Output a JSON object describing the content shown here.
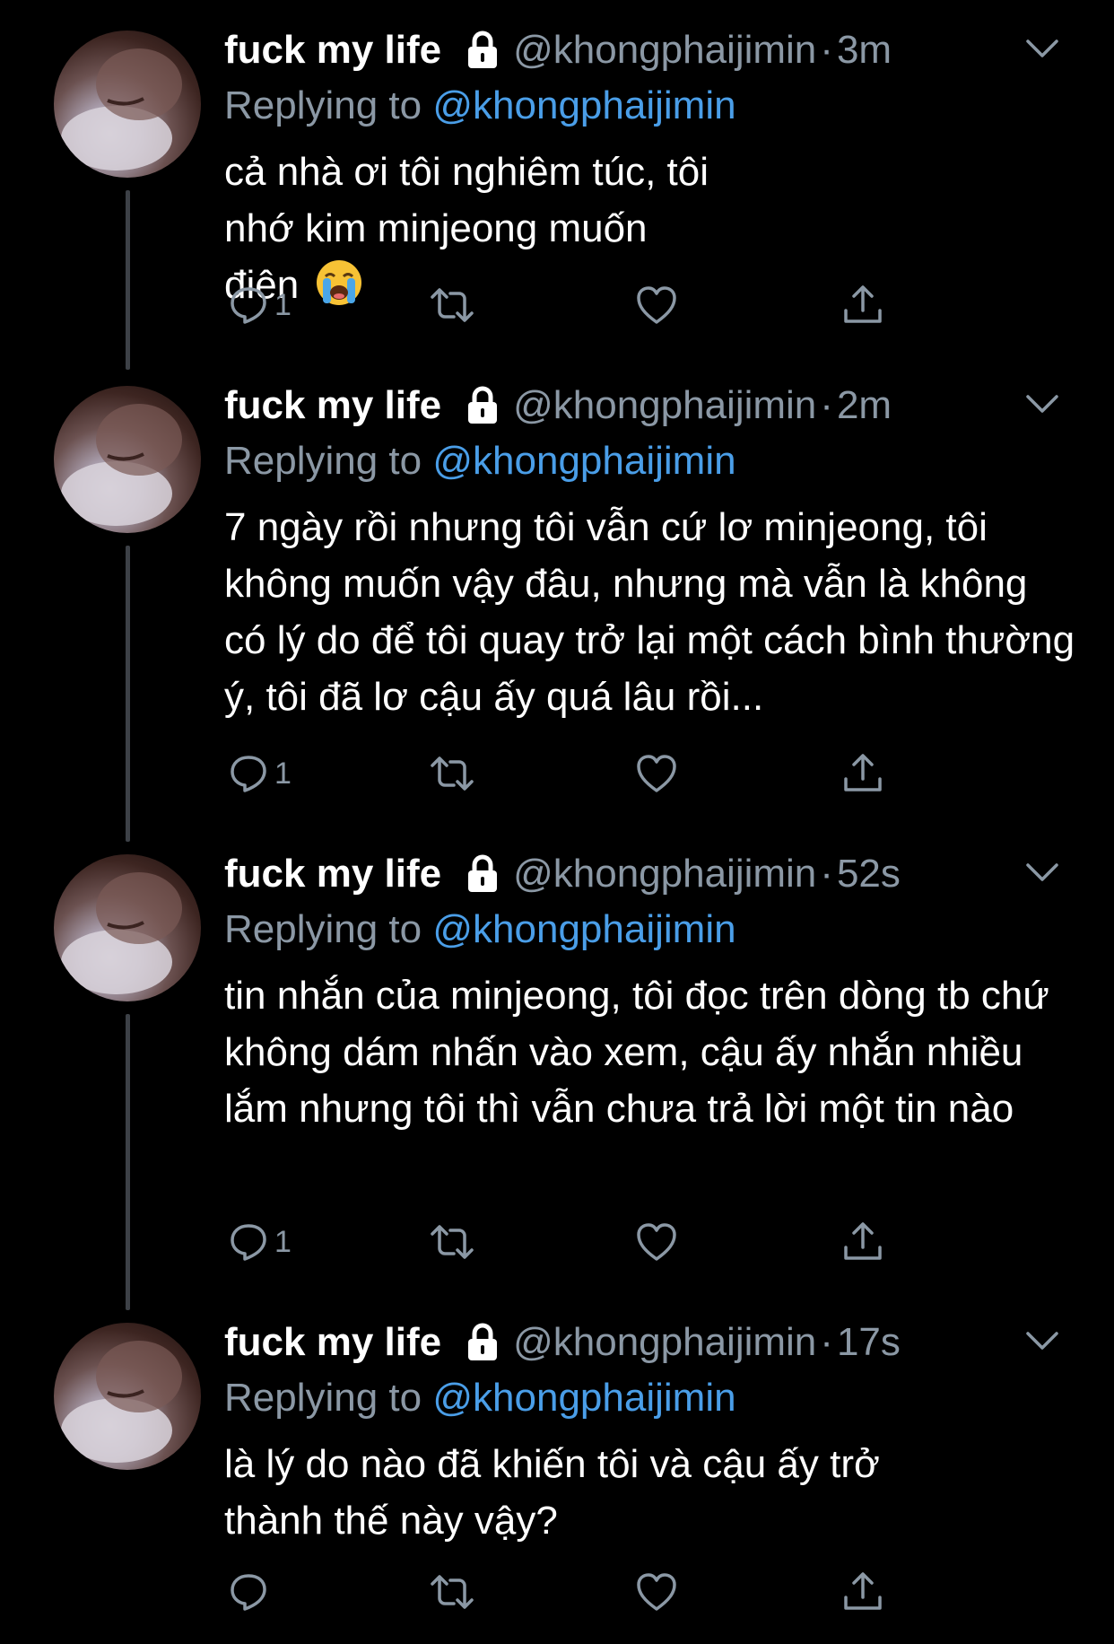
{
  "thread": {
    "colors": {
      "background": "#000000",
      "secondary_text": "#8b98a5",
      "mention": "#4a9ee8",
      "thread_line": "#3d4147"
    },
    "tweets": [
      {
        "display_name": "fuck my life",
        "handle": "@khongphaijimin",
        "separator": "·",
        "time": "3m",
        "replying_label": "Replying to",
        "replying_to": "@khongphaijimin",
        "text": "cả nhà ơi tôi nghiêm túc, tôi nhớ kim minjeong muốn điên",
        "emoji": "loudly-crying-face",
        "reply_count": "1"
      },
      {
        "display_name": "fuck my life",
        "handle": "@khongphaijimin",
        "separator": "·",
        "time": "2m",
        "replying_label": "Replying to",
        "replying_to": "@khongphaijimin",
        "text": "7 ngày rồi nhưng tôi vẫn cứ lơ minjeong, tôi không muốn vậy đâu, nhưng mà vẫn là không có lý do để tôi quay trở lại một cách bình thường ý, tôi đã lơ cậu ấy quá lâu rồi...",
        "reply_count": "1"
      },
      {
        "display_name": "fuck my life",
        "handle": "@khongphaijimin",
        "separator": "·",
        "time": "52s",
        "replying_label": "Replying to",
        "replying_to": "@khongphaijimin",
        "text": "tin nhắn của minjeong, tôi đọc trên dòng tb chứ không dám nhấn vào xem, cậu ấy nhắn nhiều lắm nhưng tôi thì vẫn chưa trả lời một tin nào",
        "reply_count": "1"
      },
      {
        "display_name": "fuck my life",
        "handle": "@khongphaijimin",
        "separator": "·",
        "time": "17s",
        "replying_label": "Replying to",
        "replying_to": "@khongphaijimin",
        "text": "là lý do nào đã khiến tôi và cậu ấy trở thành thế này vậy?",
        "reply_count": ""
      }
    ],
    "icons": {
      "lock": "lock-icon",
      "chevron": "chevron-down-icon",
      "reply": "reply-icon",
      "retweet": "retweet-icon",
      "like": "heart-icon",
      "share": "share-icon"
    }
  }
}
